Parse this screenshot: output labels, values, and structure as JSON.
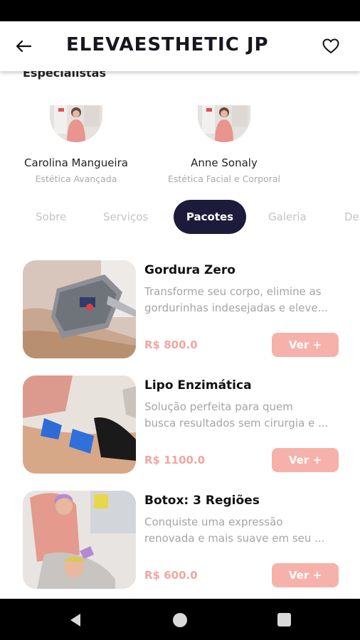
{
  "header": {
    "title": "ELEVAESTHETIC JP",
    "back_icon": "arrow-left-icon",
    "favorite_icon": "heart-outline-icon"
  },
  "specialists": {
    "section_title": "Especialistas",
    "items": [
      {
        "name": "Carolina Mangueira",
        "role": "Estética Avançada"
      },
      {
        "name": "Anne Sonaly",
        "role": "Estética Facial e Corporal"
      }
    ]
  },
  "tabs": [
    {
      "label": "Sobre"
    },
    {
      "label": "Serviços"
    },
    {
      "label": "Pacotes",
      "active": true
    },
    {
      "label": "Galeria"
    },
    {
      "label": "De"
    }
  ],
  "packages": [
    {
      "title": "Gordura Zero",
      "desc_line1": "Transforme seu corpo, elimine as",
      "desc_line2": "gordurinhas indesejadas e eleve...",
      "price": "R$ 800.0",
      "button": "Ver +"
    },
    {
      "title": "Lipo Enzimática",
      "desc_line1": "Solução perfeita para quem",
      "desc_line2": "busca resultados sem cirurgia e ...",
      "price": "R$ 1100.0",
      "button": "Ver +"
    },
    {
      "title": "Botox: 3 Regiões",
      "desc_line1": "Conquiste uma expressão",
      "desc_line2": "renovada e mais suave em seu ...",
      "price": "R$ 600.0",
      "button": "Ver +"
    }
  ],
  "colors": {
    "accent_dark": "#1d1b3b",
    "price_pink": "#f0a7a0",
    "button_pink": "#f6b2aa"
  },
  "nav": {
    "back_icon": "nav-back-icon",
    "home_icon": "nav-home-icon",
    "recent_icon": "nav-recent-icon"
  }
}
